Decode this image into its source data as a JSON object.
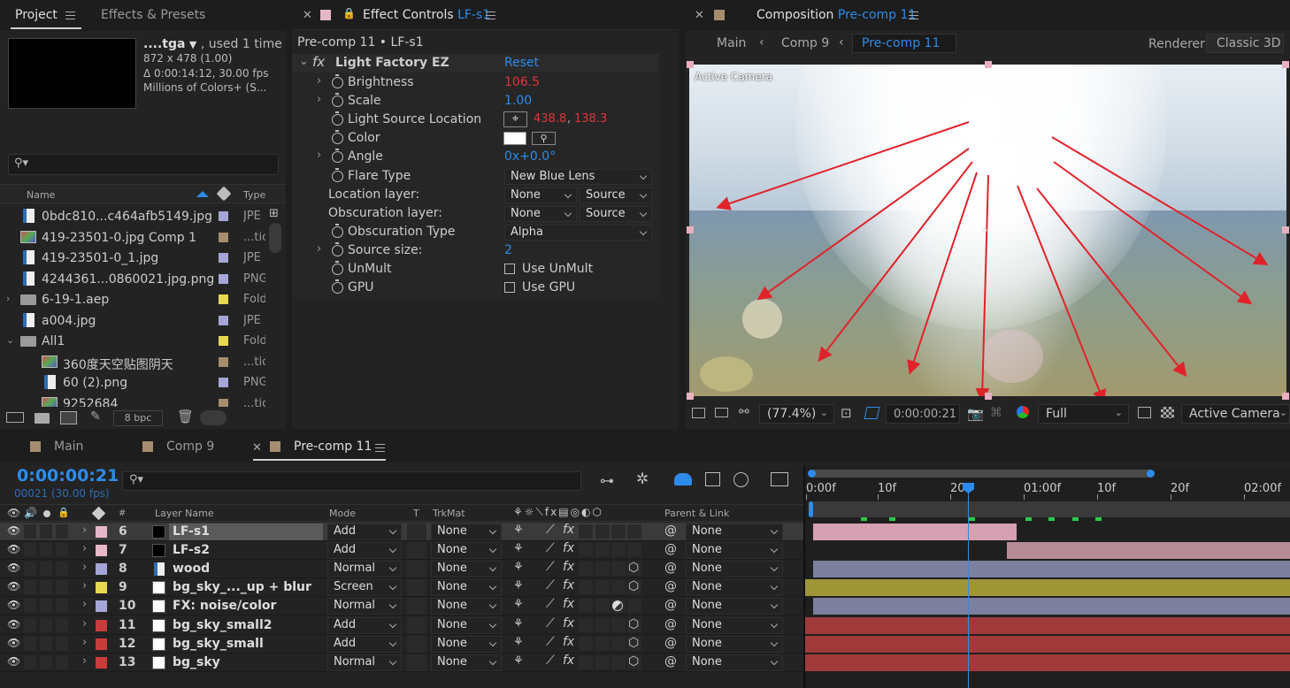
{
  "project": {
    "tab_project": "Project",
    "tab_effects": "Effects & Presets",
    "asset_name": "....tga",
    "asset_used": ", used 1 time",
    "asset_dims": "872 x 478 (1.00)",
    "asset_duration": "Δ 0:00:14:12, 30.00 fps",
    "asset_colors": "Millions of Colors+ (S...",
    "col_name": "Name",
    "col_type": "Type",
    "bpc": "8 bpc",
    "items": [
      {
        "name": "0bdc810...c464afb5149.jpg",
        "type": "JPE",
        "color": "#a5a5d6",
        "icon": "image-icon",
        "indent": 0
      },
      {
        "name": "419-23501-0.jpg Comp 1",
        "type": "...tio",
        "color": "#a58d6e",
        "icon": "comp-icon",
        "indent": 0
      },
      {
        "name": "419-23501-0_1.jpg",
        "type": "JPE",
        "color": "#a5a5d6",
        "icon": "image-icon",
        "indent": 0
      },
      {
        "name": "4244361...0860021.jpg.png",
        "type": "PNG",
        "color": "#a5a5d6",
        "icon": "image-icon",
        "indent": 0
      },
      {
        "name": "6-19-1.aep",
        "type": "Fold",
        "color": "#e6d94f",
        "icon": "folder-icon",
        "indent": 0
      },
      {
        "name": "a004.jpg",
        "type": "JPE",
        "color": "#a5a5d6",
        "icon": "image-icon",
        "indent": 0
      },
      {
        "name": "All1",
        "type": "Fold",
        "color": "#e6d94f",
        "icon": "folder-icon",
        "indent": 0
      },
      {
        "name": "360度天空贴图阴天",
        "type": "...tio",
        "color": "#a58d6e",
        "icon": "comp-icon",
        "indent": 1
      },
      {
        "name": "60 (2).png",
        "type": "PNG",
        "color": "#a5a5d6",
        "icon": "image-icon",
        "indent": 1
      },
      {
        "name": "9252684",
        "type": "...tio",
        "color": "#a58d6e",
        "icon": "comp-icon",
        "indent": 1
      }
    ]
  },
  "effects": {
    "tab_title": "Effect Controls",
    "tab_layer": "LF-s1",
    "header": "Pre-comp 11 • LF-s1",
    "effect_name": "Light Factory EZ",
    "reset": "Reset",
    "props": [
      {
        "label": "Brightness",
        "value": "106.5",
        "vclass": "red",
        "twirl": true,
        "sw": true
      },
      {
        "label": "Scale",
        "value": "1.00",
        "vclass": "blue",
        "twirl": true,
        "sw": true
      },
      {
        "label": "Light Source Location",
        "value": "438.8",
        "value2": "138.3",
        "vclass": "red",
        "twirl": false,
        "sw": true
      },
      {
        "label": "Color",
        "value": "",
        "vclass": "",
        "twirl": false,
        "sw": true
      },
      {
        "label": "Angle",
        "value": "0x+0.0°",
        "vclass": "blue",
        "twirl": true,
        "sw": true
      },
      {
        "label": "Flare Type",
        "value": "",
        "vclass": "",
        "twirl": false,
        "sw": true
      },
      {
        "label": "Location layer:",
        "value": "",
        "vclass": "",
        "twirl": false,
        "sw": false
      },
      {
        "label": "Obscuration layer:",
        "value": "",
        "vclass": "",
        "twirl": false,
        "sw": false
      },
      {
        "label": "Obscuration Type",
        "value": "",
        "vclass": "",
        "twirl": false,
        "sw": true
      },
      {
        "label": "Source size:",
        "value": "2",
        "vclass": "blue",
        "twirl": true,
        "sw": true
      },
      {
        "label": "UnMult",
        "value": "",
        "vclass": "",
        "twirl": false,
        "sw": true
      },
      {
        "label": "GPU",
        "value": "",
        "vclass": "",
        "twirl": false,
        "sw": true
      }
    ],
    "flare_type": "New Blue Lens",
    "location_layer": "None",
    "location_source": "Source",
    "obscuration_layer": "None",
    "obscuration_source": "Source",
    "obscuration_type": "Alpha",
    "unmult": "Use UnMult",
    "gpu": "Use GPU"
  },
  "comp": {
    "tab_title": "Composition",
    "tab_name": "Pre-comp 11",
    "crumb_main": "Main",
    "crumb_comp9": "Comp 9",
    "crumb_precomp": "Pre-comp 11",
    "renderer_label": "Renderer:",
    "renderer": "Classic 3D",
    "active_camera": "Active Camera",
    "zoom": "(77.4%)",
    "timecode": "0:00:00:21",
    "resolution": "Full",
    "view": "Active Camera"
  },
  "timeline": {
    "tabs": [
      {
        "label": "Main",
        "color": "#a58d6e"
      },
      {
        "label": "Comp 9",
        "color": "#a58d6e"
      },
      {
        "label": "Pre-comp 11",
        "color": "#a58d6e"
      }
    ],
    "timecode": "0:00:00:21",
    "frames": "00021 (30.00 fps)",
    "cols": {
      "layer_name": "Layer Name",
      "mode": "Mode",
      "t": "T",
      "trkmat": "TrkMat",
      "parent": "Parent & Link"
    },
    "ruler": [
      "0:00f",
      "10f",
      "20f",
      "01:00f",
      "10f",
      "20f",
      "02:00f"
    ],
    "layers": [
      {
        "num": "6",
        "name": "LF-s1",
        "mode": "Add",
        "trk": "None",
        "parent": "None",
        "color": "#e4b8c8",
        "thumb": "#000",
        "bar": "#d79fb2",
        "bar_start": 0,
        "bar_end": 0.42,
        "selected": true,
        "three": false,
        "adj": false
      },
      {
        "num": "7",
        "name": "LF-s2",
        "mode": "Add",
        "trk": "None",
        "parent": "None",
        "color": "#e4b8c8",
        "thumb": "#000",
        "bar": "#b58c98",
        "bar_start": 0.4,
        "bar_end": 1,
        "selected": false,
        "three": false,
        "adj": false
      },
      {
        "num": "8",
        "name": "wood",
        "mode": "Normal",
        "trk": "None",
        "parent": "None",
        "color": "#a5a5d6",
        "thumb": "image",
        "bar": "#7d7f9e",
        "bar_start": 0,
        "bar_end": 1,
        "selected": false,
        "three": true,
        "adj": false
      },
      {
        "num": "9",
        "name": "bg_sky_..._up + blur",
        "mode": "Screen",
        "trk": "None",
        "parent": "None",
        "color": "#e6d94f",
        "thumb": "#fff",
        "bar": "#9e9637",
        "bar_start": -0.02,
        "bar_end": 1,
        "selected": false,
        "three": true,
        "adj": false
      },
      {
        "num": "10",
        "name": "FX: noise/color",
        "mode": "Normal",
        "trk": "None",
        "parent": "None",
        "color": "#a5a5d6",
        "thumb": "#fff",
        "bar": "#7d7f9e",
        "bar_start": 0,
        "bar_end": 1,
        "selected": false,
        "three": false,
        "adj": true
      },
      {
        "num": "11",
        "name": "bg_sky_small2",
        "mode": "Add",
        "trk": "None",
        "parent": "None",
        "color": "#c93c3c",
        "thumb": "#fff",
        "bar": "#a03a3a",
        "bar_start": -0.02,
        "bar_end": 1,
        "selected": false,
        "three": true,
        "adj": false
      },
      {
        "num": "12",
        "name": "bg_sky_small",
        "mode": "Add",
        "trk": "None",
        "parent": "None",
        "color": "#c93c3c",
        "thumb": "#fff",
        "bar": "#a03a3a",
        "bar_start": -0.02,
        "bar_end": 1,
        "selected": false,
        "three": true,
        "adj": false
      },
      {
        "num": "13",
        "name": "bg_sky",
        "mode": "Normal",
        "trk": "None",
        "parent": "None",
        "color": "#c93c3c",
        "thumb": "#fff",
        "bar": "#a03a3a",
        "bar_start": -0.02,
        "bar_end": 1,
        "selected": false,
        "three": true,
        "adj": false
      }
    ]
  }
}
